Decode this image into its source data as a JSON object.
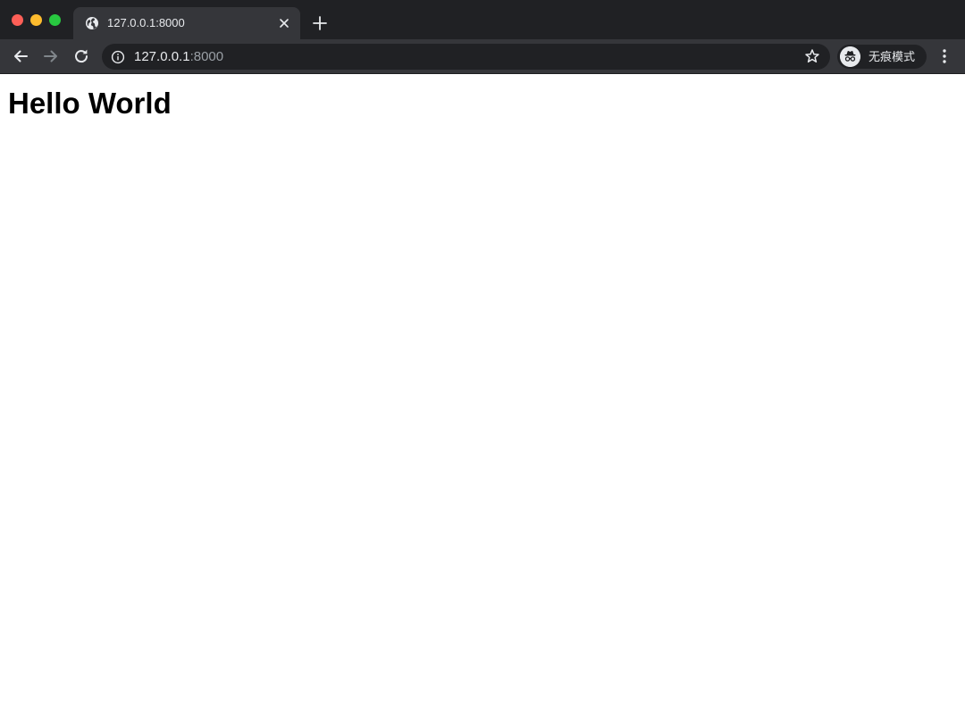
{
  "browser": {
    "tab": {
      "title": "127.0.0.1:8000",
      "favicon": "globe-icon",
      "close_icon": "close-icon"
    },
    "new_tab_icon": "plus-icon",
    "toolbar": {
      "back_icon": "arrow-left-icon",
      "forward_icon": "arrow-right-icon",
      "reload_icon": "reload-icon",
      "address": {
        "host": "127.0.0.1",
        "port": ":8000",
        "info_icon": "info-icon",
        "bookmark_icon": "star-icon"
      },
      "profile": {
        "label": "无痕模式",
        "icon": "incognito-icon"
      },
      "menu_icon": "kebab-menu-icon"
    },
    "colors": {
      "tabstrip": "#202124",
      "toolbar": "#35363a",
      "omnibox": "#202124",
      "text": "#e8eaed",
      "muted_text": "#9aa0a6"
    }
  },
  "page": {
    "heading": "Hello World"
  }
}
